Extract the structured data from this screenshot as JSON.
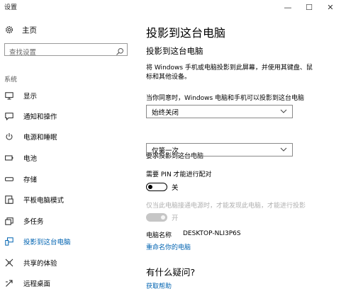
{
  "window": {
    "title": "设置",
    "minimize_glyph": "—",
    "maximize_glyph": "☐",
    "close_glyph": "✕"
  },
  "sidebar": {
    "home_label": "主页",
    "search_placeholder": "查找设置",
    "section_label": "系统",
    "items": [
      {
        "label": "显示",
        "icon": "monitor-icon"
      },
      {
        "label": "通知和操作",
        "icon": "notification-icon"
      },
      {
        "label": "电源和睡眠",
        "icon": "power-icon"
      },
      {
        "label": "电池",
        "icon": "battery-icon"
      },
      {
        "label": "存储",
        "icon": "storage-icon"
      },
      {
        "label": "平板电脑模式",
        "icon": "tablet-mode-icon"
      },
      {
        "label": "多任务",
        "icon": "multitasking-icon"
      },
      {
        "label": "投影到这台电脑",
        "icon": "project-icon",
        "active": true
      },
      {
        "label": "共享的体验",
        "icon": "shared-experiences-icon"
      },
      {
        "label": "远程桌面",
        "icon": "remote-desktop-icon"
      }
    ]
  },
  "main": {
    "page_title": "投影到这台电脑",
    "section_title": "投影到这台电脑",
    "description": "将 Windows 手机或电脑投影到此屏幕，并使用其键盘、鼠标和其他设备。",
    "availability_label": "当你同意时，Windows 电脑和手机可以投影到这台电脑",
    "availability_value": "始终关闭",
    "ask_label": "要求投影到这台电脑",
    "ask_value": "仅第一次",
    "pin_label": "需要 PIN 才能进行配对",
    "pin_state": "关",
    "plugged_label": "仅当此电脑接通电源时，才能发现此电脑，才能进行投影",
    "plugged_state": "开",
    "pc_name_label": "电脑名称",
    "pc_name_value": "DESKTOP-NLI3P6S",
    "rename_link": "重命名你的电脑",
    "question_title": "有什么疑问?",
    "help_link": "获取帮助"
  },
  "colors": {
    "accent": "#0063b1",
    "disabled_text": "#b0b0b0",
    "toggle_disabled": "#c6c6c6"
  }
}
